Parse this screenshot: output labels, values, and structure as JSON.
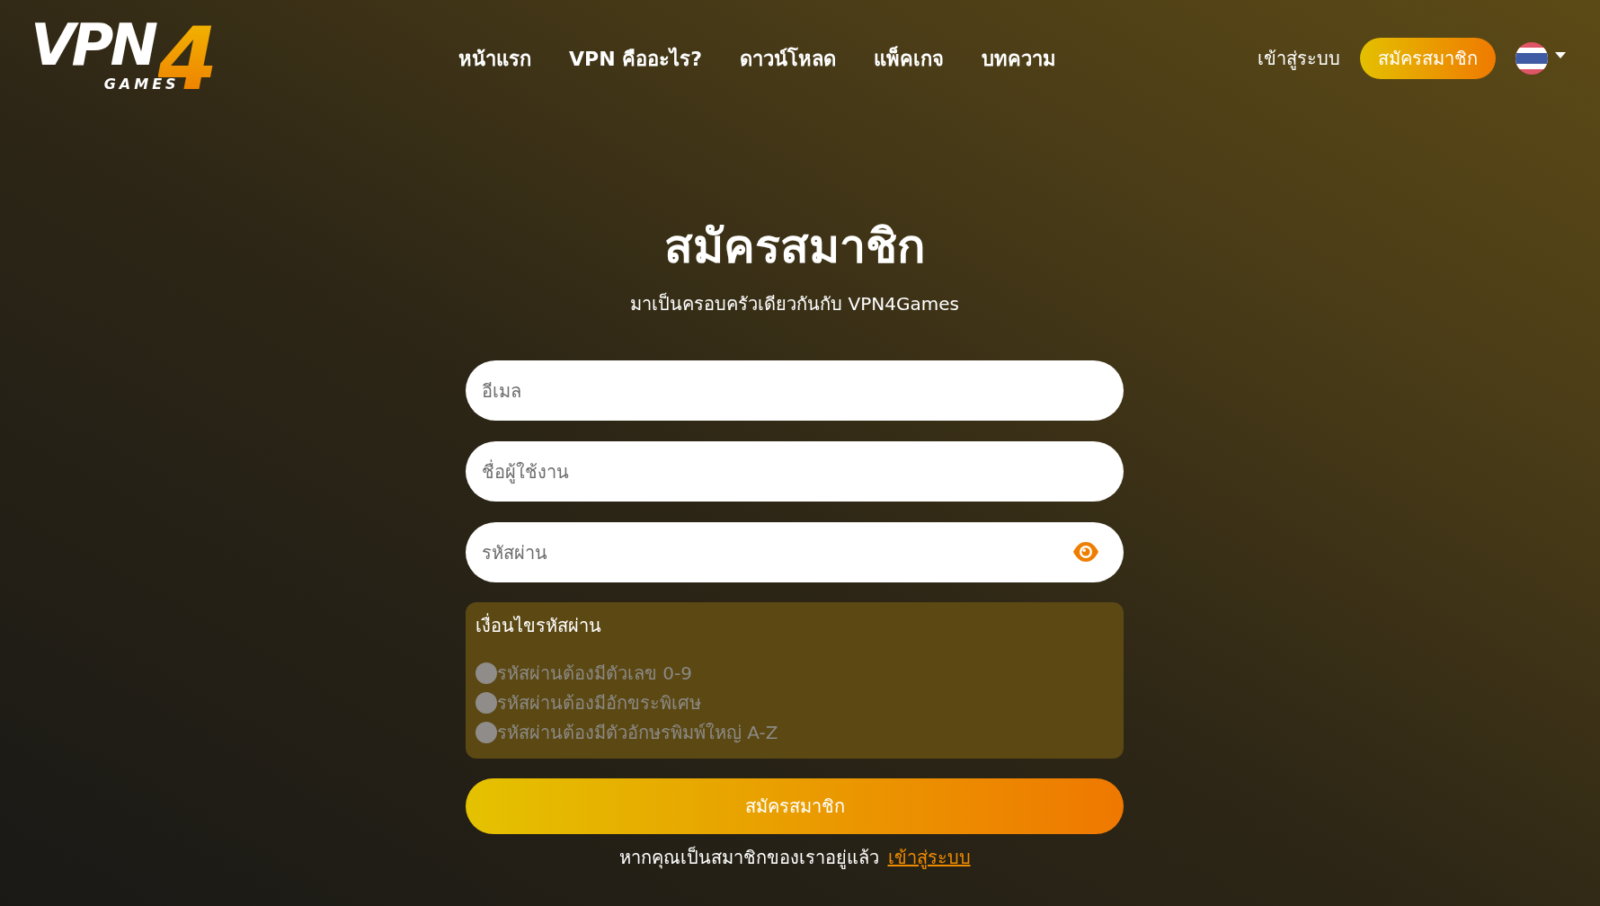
{
  "header": {
    "logo": {
      "title": "VPN",
      "numeral": "4",
      "tagline": "GAMES"
    },
    "nav": [
      "หน้าแรก",
      "VPN คืออะไร?",
      "ดาวน์โหลด",
      "แพ็คเกจ",
      "บทความ"
    ],
    "login_link": "เข้าสู่ระบบ",
    "register_button": "สมัครสมาชิก"
  },
  "form": {
    "title": "สมัครสมาชิก",
    "subtitle": "มาเป็นครอบครัวเดียวกันกับ VPN4Games",
    "fields": [
      {
        "kind": "text",
        "placeholder": "อีเมล"
      },
      {
        "kind": "text",
        "placeholder": "ชื่อผู้ใช้งาน"
      },
      {
        "kind": "password",
        "placeholder": "รหัสผ่าน"
      }
    ],
    "requirements": {
      "title": "เงื่อนไขรหัสผ่าน",
      "items": [
        {
          "label": "รหัสผ่านต้องมีตัวเลข 0-9",
          "met": false
        },
        {
          "label": "รหัสผ่านต้องมีอักขระพิเศษ",
          "met": false
        },
        {
          "label": "รหัสผ่านต้องมีตัวอักษรพิมพ์ใหญ่ A-Z",
          "met": false
        }
      ]
    },
    "submit_button": "สมัครสมาชิก",
    "login_prompt": {
      "text": "หากคุณเป็นสมาชิกของเราอยู่แล้ว",
      "link": "เข้าสู่ระบบ"
    }
  }
}
